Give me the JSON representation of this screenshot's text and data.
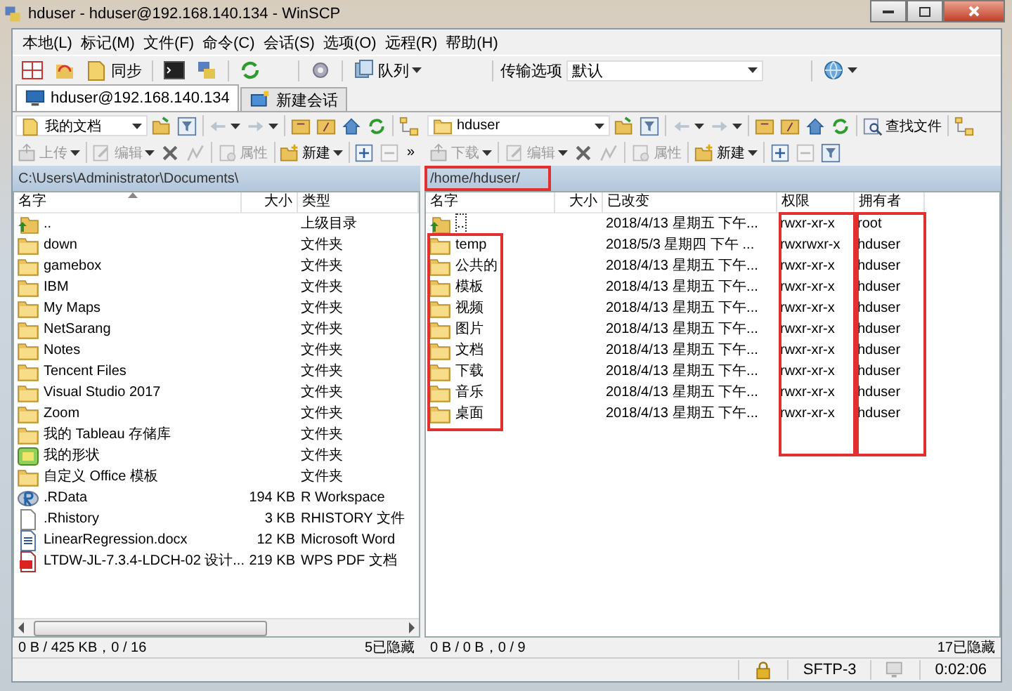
{
  "window": {
    "title": "hduser - hduser@192.168.140.134 - WinSCP"
  },
  "menu": [
    "本地(L)",
    "标记(M)",
    "文件(F)",
    "命令(C)",
    "会话(S)",
    "选项(O)",
    "远程(R)",
    "帮助(H)"
  ],
  "toolbar": {
    "sync_label": "同步",
    "queue_label": "队列",
    "transfer_label": "传输选项",
    "transfer_value": "默认"
  },
  "tabs": [
    {
      "label": "hduser@192.168.140.134",
      "selected": true,
      "kind": "session"
    },
    {
      "label": "新建会话",
      "selected": false,
      "kind": "new"
    }
  ],
  "local": {
    "location": "我的文档",
    "path": "C:\\Users\\Administrator\\Documents\\",
    "actions": [
      {
        "label": "上传",
        "disabled": true
      },
      {
        "label": "编辑",
        "disabled": true
      },
      {
        "label": "属性",
        "disabled": true
      },
      {
        "label": "新建",
        "disabled": false
      }
    ],
    "more": "»",
    "columns": [
      {
        "label": "名字",
        "sorted": true
      },
      {
        "label": "大小",
        "sorted": false
      },
      {
        "label": "类型",
        "sorted": false
      }
    ],
    "rows": [
      {
        "kind": "parent",
        "cells": [
          "..",
          "",
          "上级目录"
        ]
      },
      {
        "kind": "folder",
        "cells": [
          "down",
          "",
          "文件夹"
        ]
      },
      {
        "kind": "folder",
        "cells": [
          "gamebox",
          "",
          "文件夹"
        ]
      },
      {
        "kind": "folder",
        "cells": [
          "IBM",
          "",
          "文件夹"
        ]
      },
      {
        "kind": "folder",
        "cells": [
          "My Maps",
          "",
          "文件夹"
        ]
      },
      {
        "kind": "folder",
        "cells": [
          "NetSarang",
          "",
          "文件夹"
        ]
      },
      {
        "kind": "folder",
        "cells": [
          "Notes",
          "",
          "文件夹"
        ]
      },
      {
        "kind": "folder",
        "cells": [
          "Tencent Files",
          "",
          "文件夹"
        ]
      },
      {
        "kind": "folder",
        "cells": [
          "Visual Studio 2017",
          "",
          "文件夹"
        ]
      },
      {
        "kind": "folder",
        "cells": [
          "Zoom",
          "",
          "文件夹"
        ]
      },
      {
        "kind": "folder",
        "cells": [
          "我的 Tableau 存储库",
          "",
          "文件夹"
        ]
      },
      {
        "kind": "shapes",
        "cells": [
          "我的形状",
          "",
          "文件夹"
        ]
      },
      {
        "kind": "folder",
        "cells": [
          "自定义 Office 模板",
          "",
          "文件夹"
        ]
      },
      {
        "kind": "rdata",
        "cells": [
          ".RData",
          "194 KB",
          "R Workspace"
        ]
      },
      {
        "kind": "text",
        "cells": [
          ".Rhistory",
          "3 KB",
          "RHISTORY 文件"
        ]
      },
      {
        "kind": "doc",
        "cells": [
          "LinearRegression.docx",
          "12 KB",
          "Microsoft Word"
        ]
      },
      {
        "kind": "pdf",
        "cells": [
          "LTDW-JL-7.3.4-LDCH-02 设计...",
          "219 KB",
          "WPS PDF 文档"
        ]
      }
    ],
    "status": "0 B / 425 KB，0 / 16",
    "hidden": "5已隐藏"
  },
  "remote": {
    "location": "hduser",
    "find_label": "查找文件",
    "path": "/home/hduser/",
    "highlight_frames": [
      {
        "kind": "path"
      },
      {
        "kind": "names"
      },
      {
        "kind": "permissions"
      },
      {
        "kind": "owners"
      }
    ],
    "actions": [
      {
        "label": "下载",
        "disabled": true
      },
      {
        "label": "编辑",
        "disabled": true
      },
      {
        "label": "属性",
        "disabled": true
      },
      {
        "label": "新建",
        "disabled": false
      }
    ],
    "columns": [
      {
        "label": "名字",
        "sorted": false
      },
      {
        "label": "大小",
        "sorted": false
      },
      {
        "label": "已改变",
        "sorted": false
      },
      {
        "label": "权限",
        "sorted": false
      },
      {
        "label": "拥有者",
        "sorted": false
      }
    ],
    "rows": [
      {
        "kind": "parent",
        "focused": true,
        "cells": [
          "..",
          "",
          "2018/4/13 星期五 下午...",
          "rwxr-xr-x",
          "root"
        ]
      },
      {
        "kind": "folder",
        "focused": false,
        "cells": [
          "temp",
          "",
          "2018/5/3 星期四 下午 ...",
          "rwxrwxr-x",
          "hduser"
        ]
      },
      {
        "kind": "folder",
        "focused": false,
        "cells": [
          "公共的",
          "",
          "2018/4/13 星期五 下午...",
          "rwxr-xr-x",
          "hduser"
        ]
      },
      {
        "kind": "folder",
        "focused": false,
        "cells": [
          "模板",
          "",
          "2018/4/13 星期五 下午...",
          "rwxr-xr-x",
          "hduser"
        ]
      },
      {
        "kind": "folder",
        "focused": false,
        "cells": [
          "视频",
          "",
          "2018/4/13 星期五 下午...",
          "rwxr-xr-x",
          "hduser"
        ]
      },
      {
        "kind": "folder",
        "focused": false,
        "cells": [
          "图片",
          "",
          "2018/4/13 星期五 下午...",
          "rwxr-xr-x",
          "hduser"
        ]
      },
      {
        "kind": "folder",
        "focused": false,
        "cells": [
          "文档",
          "",
          "2018/4/13 星期五 下午...",
          "rwxr-xr-x",
          "hduser"
        ]
      },
      {
        "kind": "folder",
        "focused": false,
        "cells": [
          "下载",
          "",
          "2018/4/13 星期五 下午...",
          "rwxr-xr-x",
          "hduser"
        ]
      },
      {
        "kind": "folder",
        "focused": false,
        "cells": [
          "音乐",
          "",
          "2018/4/13 星期五 下午...",
          "rwxr-xr-x",
          "hduser"
        ]
      },
      {
        "kind": "folder",
        "focused": false,
        "cells": [
          "桌面",
          "",
          "2018/4/13 星期五 下午...",
          "rwxr-xr-x",
          "hduser"
        ]
      }
    ],
    "status": "0 B / 0 B，0 / 9",
    "hidden": "17已隐藏"
  },
  "status_bar": {
    "protocol": "SFTP-3",
    "elapsed": "0:02:06"
  }
}
